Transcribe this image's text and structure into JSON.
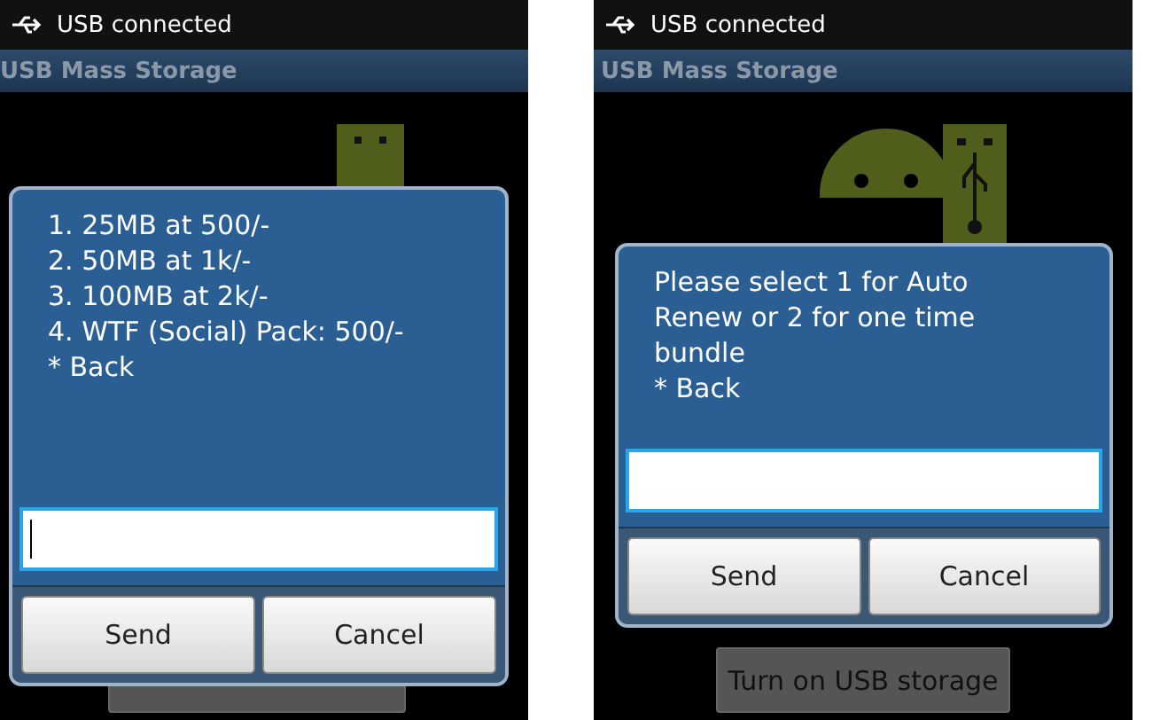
{
  "phones": [
    {
      "status": "USB connected",
      "title": "USB Mass Storage",
      "graphic": {
        "kind": "usb"
      },
      "dialog": {
        "lines": [
          "1. 25MB at 500/-",
          "2. 50MB at 1k/-",
          "3. 100MB at 2k/-",
          "4. WTF (Social) Pack: 500/-",
          "* Back"
        ],
        "cursor": true,
        "buttons": [
          "Send",
          "Cancel"
        ]
      },
      "storage_button": {
        "kind": "covered"
      }
    },
    {
      "status": "USB connected",
      "title": "USB Mass Storage",
      "graphic": {
        "kind": "android-usb"
      },
      "dialog": {
        "lines": [
          "Please select 1 for Auto Renew or 2 for one time bundle",
          "* Back"
        ],
        "cursor": false,
        "buttons": [
          "Send",
          "Cancel"
        ]
      },
      "storage_button": {
        "kind": "labeled",
        "label": "Turn on USB storage"
      }
    }
  ]
}
